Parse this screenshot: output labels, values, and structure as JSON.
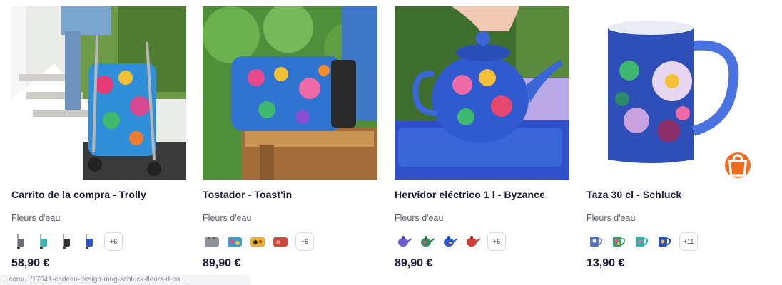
{
  "products": [
    {
      "title": "Carrito de la compra - Trolly",
      "collection": "Fleurs d'eau",
      "swatch_icons": [
        "trolley-grey-icon",
        "trolley-teal-icon",
        "trolley-black-icon",
        "trolley-blue-icon"
      ],
      "more_colors": "+6",
      "price": "58,90 €",
      "image_icon": "floral-trolley-photo"
    },
    {
      "title": "Tostador - Toast'in",
      "collection": "Fleurs d'eau",
      "swatch_icons": [
        "toaster-grey-icon",
        "toaster-multicolor-icon",
        "toaster-yellow-icon",
        "toaster-red-icon"
      ],
      "more_colors": "+6",
      "price": "89,90 €",
      "image_icon": "floral-toaster-photo"
    },
    {
      "title": "Hervidor eléctrico 1 l - Byzance",
      "collection": "Fleurs d'eau",
      "swatch_icons": [
        "kettle-purple-icon",
        "kettle-green-icon",
        "kettle-blue-icon",
        "kettle-red-icon"
      ],
      "more_colors": "+6",
      "price": "89,90 €",
      "image_icon": "floral-kettle-photo"
    },
    {
      "title": "Taza 30 cl - Schluck",
      "collection": "Fleurs d'eau",
      "swatch_icons": [
        "mug-blue-icon",
        "mug-multicolor-icon",
        "mug-teal-icon",
        "mug-darkblue-icon"
      ],
      "more_colors": "+11",
      "price": "13,90 €",
      "image_icon": "floral-mug-photo",
      "has_cart_button": true
    }
  ],
  "status_bar": {
    "url": "...com/.../17041-cadeau-design-mug-schluck-fleurs-d-ea..."
  },
  "colors": {
    "accent_orange": "#f26a1b",
    "title_navy": "#1b1d3a",
    "subtext": "#5d5d6a"
  }
}
